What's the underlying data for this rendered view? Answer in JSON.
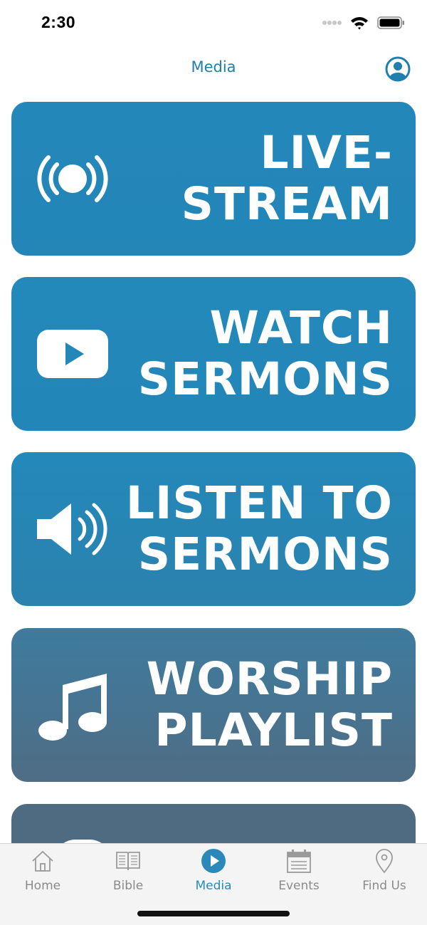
{
  "status_bar": {
    "time": "2:30",
    "icons": [
      "signal-dots-icon",
      "wifi-icon",
      "battery-icon"
    ]
  },
  "nav": {
    "title": "Media",
    "profile_icon": "profile-icon"
  },
  "colors": {
    "accent": "#1f7fad",
    "tile_blue": "#2387b8",
    "tile_slate": "#4d7490",
    "tab_active": "#2a89b8",
    "tab_inactive": "#8a8a8a"
  },
  "tiles": [
    {
      "icon": "livestream-icon",
      "line1": "LIVE-",
      "line2": "STREAM"
    },
    {
      "icon": "video-play-icon",
      "line1": "WATCH",
      "line2": "SERMONS"
    },
    {
      "icon": "speaker-icon",
      "line1": "LISTEN TO",
      "line2": "SERMONS"
    },
    {
      "icon": "music-note-icon",
      "line1": "WORSHIP",
      "line2": "PLAYLIST"
    }
  ],
  "tabs": [
    {
      "label": "Home",
      "icon": "home-icon",
      "active": false
    },
    {
      "label": "Bible",
      "icon": "book-icon",
      "active": false
    },
    {
      "label": "Media",
      "icon": "play-circle-icon",
      "active": true
    },
    {
      "label": "Events",
      "icon": "calendar-icon",
      "active": false
    },
    {
      "label": "Find Us",
      "icon": "map-pin-icon",
      "active": false
    }
  ]
}
